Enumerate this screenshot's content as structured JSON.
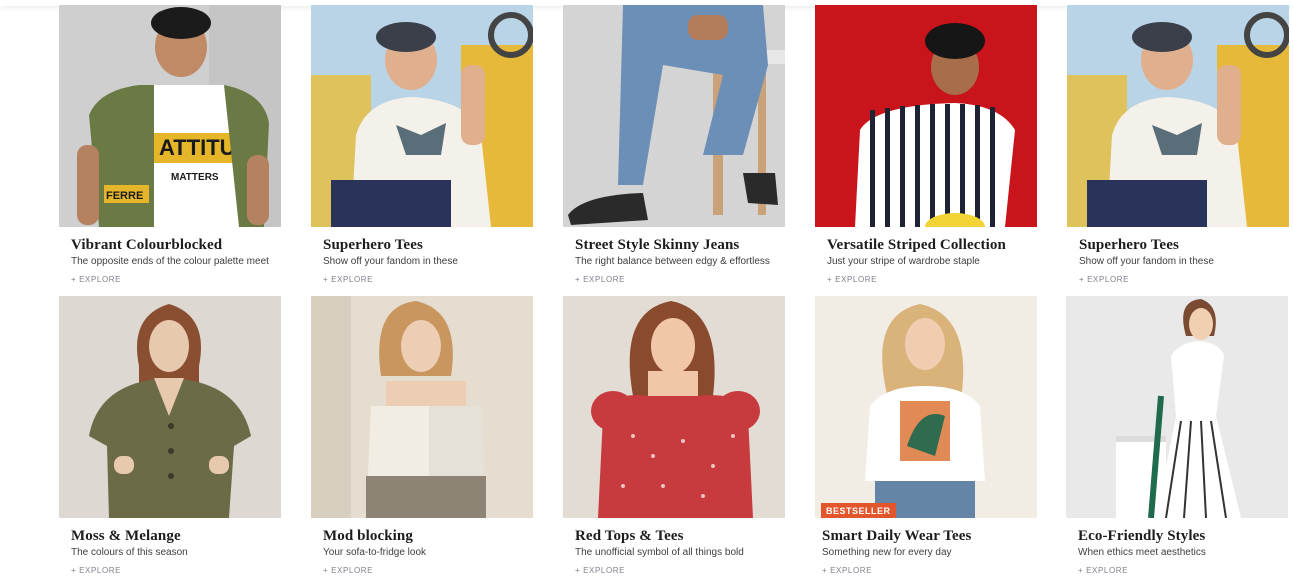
{
  "collections": [
    {
      "title": "Vibrant Colourblocked",
      "subtitle": "The opposite ends of the colour palette meet",
      "cta": "+ EXPLORE",
      "image_text": "ATTITU",
      "image_text2": "MATTERS",
      "image_text3": "FERRE",
      "colors": {
        "bg": "#cfcfcf",
        "main": "#ffffff",
        "accent": "#6b7a45",
        "accent2": "#e6b62a"
      }
    },
    {
      "title": "Superhero Tees",
      "subtitle": "Show off your fandom in these",
      "cta": "+ EXPLORE",
      "colors": {
        "bg": "#b9d4e6",
        "main": "#f4f1ea",
        "accent": "#2a335a",
        "accent2": "#e7b93a"
      }
    },
    {
      "title": "Street Style Skinny Jeans",
      "subtitle": "The right balance between edgy & effortless",
      "cta": "+ EXPLORE",
      "colors": {
        "bg": "#d4d4d4",
        "main": "#6c8fb8",
        "accent": "#2a2a2a",
        "accent2": "#e8e8e8"
      }
    },
    {
      "title": "Versatile Striped Collection",
      "subtitle": "Just your stripe of wardrobe staple",
      "cta": "+ EXPLORE",
      "colors": {
        "bg": "#c8141a",
        "main": "#ffffff",
        "accent": "#1e2235",
        "accent2": "#f2d437"
      }
    },
    {
      "title": "Superhero Tees",
      "subtitle": "Show off your fandom in these",
      "cta": "+ EXPLORE",
      "colors": {
        "bg": "#b9d4e6",
        "main": "#f4f1ea",
        "accent": "#2a335a",
        "accent2": "#e7b93a"
      }
    },
    {
      "title": "Moss & Melange",
      "subtitle": "The colours of this season",
      "cta": "+ EXPLORE",
      "colors": {
        "bg": "#ddd8d2",
        "main": "#6c6b48",
        "accent": "#8a4f30",
        "accent2": "#e7c9ad"
      }
    },
    {
      "title": "Mod blocking",
      "subtitle": "Your sofa-to-fridge look",
      "cta": "+ EXPLORE",
      "colors": {
        "bg": "#e6ddd1",
        "main": "#f2ede2",
        "accent": "#8d8475",
        "accent2": "#c8965e"
      }
    },
    {
      "title": "Red Tops & Tees",
      "subtitle": "The unofficial symbol of all things bold",
      "cta": "+ EXPLORE",
      "colors": {
        "bg": "#e3dcd4",
        "main": "#c73a3e",
        "accent": "#8a4a2e",
        "accent2": "#f1c7a8"
      }
    },
    {
      "title": "Smart Daily Wear Tees",
      "subtitle": "Something new for every day",
      "cta": "+ EXPLORE",
      "badge": "BESTSELLER",
      "colors": {
        "bg": "#f1ece4",
        "main": "#ffffff",
        "accent": "#6485a6",
        "accent2": "#e28a55"
      }
    },
    {
      "title": "Eco-Friendly Styles",
      "subtitle": "When ethics meet aesthetics",
      "cta": "+ EXPLORE",
      "colors": {
        "bg": "#e9e9e9",
        "main": "#ffffff",
        "accent": "#1e6b4e",
        "accent2": "#7a4a32"
      }
    }
  ]
}
